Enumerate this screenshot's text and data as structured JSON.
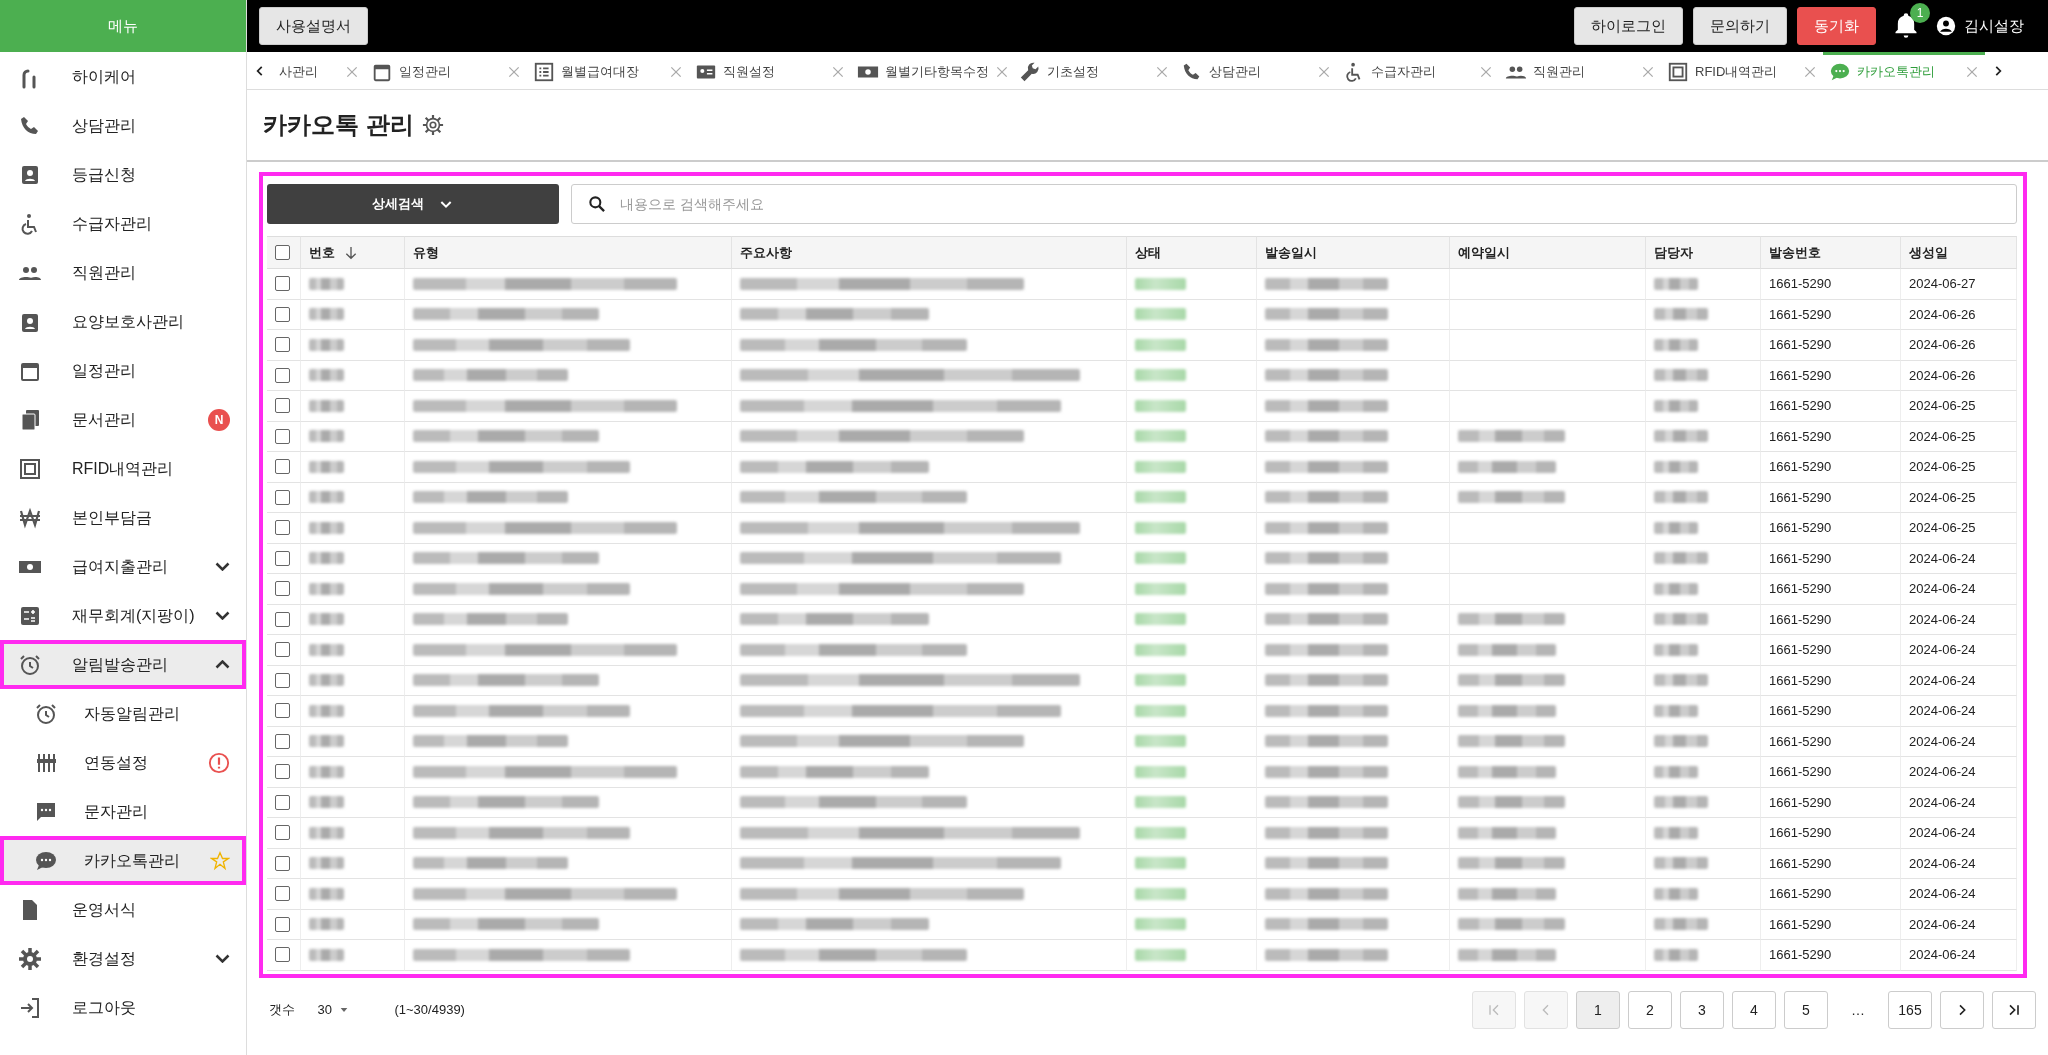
{
  "sidebar": {
    "title": "메뉴",
    "items": [
      {
        "label": "하이케어",
        "selected": false
      },
      {
        "label": "상담관리",
        "selected": false
      },
      {
        "label": "등급신청",
        "selected": false
      },
      {
        "label": "수급자관리",
        "selected": false
      },
      {
        "label": "직원관리",
        "selected": false
      },
      {
        "label": "요양보호사관리",
        "selected": false
      },
      {
        "label": "일정관리",
        "selected": false
      },
      {
        "label": "문서관리",
        "selected": false,
        "badge": "N"
      },
      {
        "label": "RFID내역관리",
        "selected": false
      },
      {
        "label": "본인부담금",
        "selected": false
      },
      {
        "label": "급여지출관리",
        "selected": false,
        "expanded": false
      },
      {
        "label": "재무회계(지팡이)",
        "selected": false,
        "expanded": false
      },
      {
        "label": "알림발송관리",
        "selected": true,
        "outlined": true,
        "expanded": true,
        "children": [
          {
            "label": "자동알림관리",
            "selected": false
          },
          {
            "label": "연동설정",
            "selected": false,
            "warning": true
          },
          {
            "label": "문자관리",
            "selected": false
          },
          {
            "label": "카카오톡관리",
            "selected": true,
            "outlined": true,
            "starred": false
          }
        ]
      },
      {
        "label": "운영서식",
        "selected": false
      },
      {
        "label": "환경설정",
        "selected": false,
        "expanded": false
      },
      {
        "label": "로그아웃",
        "selected": false
      }
    ]
  },
  "topbar": {
    "manual_button": "사용설명서",
    "buttons": [
      {
        "label": "하이로그인",
        "kind": "plain"
      },
      {
        "label": "문의하기",
        "kind": "plain"
      },
      {
        "label": "동기화",
        "kind": "danger"
      }
    ],
    "notification_count": "1",
    "user": "김시설장"
  },
  "tabs": [
    {
      "label": "사관리",
      "selected": false
    },
    {
      "label": "일정관리",
      "selected": false
    },
    {
      "label": "월별급여대장",
      "selected": false
    },
    {
      "label": "직원설정",
      "selected": false
    },
    {
      "label": "월별기타항목수정",
      "selected": false
    },
    {
      "label": "기초설정",
      "selected": false
    },
    {
      "label": "상담관리",
      "selected": false
    },
    {
      "label": "수급자관리",
      "selected": false
    },
    {
      "label": "직원관리",
      "selected": false
    },
    {
      "label": "RFID내역관리",
      "selected": false
    },
    {
      "label": "카카오톡관리",
      "selected": true
    }
  ],
  "page": {
    "title": "카카오톡 관리",
    "outlined": true
  },
  "search": {
    "filter_button": "상세검색",
    "placeholder": "내용으로 검색해주세요"
  },
  "table": {
    "all_checked": false,
    "columns": [
      "번호",
      "유형",
      "주요사항",
      "상태",
      "발송일시",
      "예약일시",
      "담당자",
      "발송번호",
      "생성일"
    ],
    "rows": [
      {
        "checked": false,
        "scheduled": false,
        "sender_number": "1661-5290",
        "created": "2024-06-27"
      },
      {
        "checked": false,
        "scheduled": false,
        "sender_number": "1661-5290",
        "created": "2024-06-26"
      },
      {
        "checked": false,
        "scheduled": false,
        "sender_number": "1661-5290",
        "created": "2024-06-26"
      },
      {
        "checked": false,
        "scheduled": false,
        "sender_number": "1661-5290",
        "created": "2024-06-26"
      },
      {
        "checked": false,
        "scheduled": false,
        "sender_number": "1661-5290",
        "created": "2024-06-25"
      },
      {
        "checked": false,
        "scheduled": true,
        "sender_number": "1661-5290",
        "created": "2024-06-25"
      },
      {
        "checked": false,
        "scheduled": true,
        "sender_number": "1661-5290",
        "created": "2024-06-25"
      },
      {
        "checked": false,
        "scheduled": true,
        "sender_number": "1661-5290",
        "created": "2024-06-25"
      },
      {
        "checked": false,
        "scheduled": false,
        "sender_number": "1661-5290",
        "created": "2024-06-25"
      },
      {
        "checked": false,
        "scheduled": false,
        "sender_number": "1661-5290",
        "created": "2024-06-24"
      },
      {
        "checked": false,
        "scheduled": false,
        "sender_number": "1661-5290",
        "created": "2024-06-24"
      },
      {
        "checked": false,
        "scheduled": true,
        "sender_number": "1661-5290",
        "created": "2024-06-24"
      },
      {
        "checked": false,
        "scheduled": true,
        "sender_number": "1661-5290",
        "created": "2024-06-24"
      },
      {
        "checked": false,
        "scheduled": true,
        "sender_number": "1661-5290",
        "created": "2024-06-24"
      },
      {
        "checked": false,
        "scheduled": true,
        "sender_number": "1661-5290",
        "created": "2024-06-24"
      },
      {
        "checked": false,
        "scheduled": true,
        "sender_number": "1661-5290",
        "created": "2024-06-24"
      },
      {
        "checked": false,
        "scheduled": true,
        "sender_number": "1661-5290",
        "created": "2024-06-24"
      },
      {
        "checked": false,
        "scheduled": true,
        "sender_number": "1661-5290",
        "created": "2024-06-24"
      },
      {
        "checked": false,
        "scheduled": true,
        "sender_number": "1661-5290",
        "created": "2024-06-24"
      },
      {
        "checked": false,
        "scheduled": true,
        "sender_number": "1661-5290",
        "created": "2024-06-24"
      },
      {
        "checked": false,
        "scheduled": true,
        "sender_number": "1661-5290",
        "created": "2024-06-24"
      },
      {
        "checked": false,
        "scheduled": true,
        "sender_number": "1661-5290",
        "created": "2024-06-24"
      },
      {
        "checked": false,
        "scheduled": true,
        "sender_number": "1661-5290",
        "created": "2024-06-24"
      }
    ]
  },
  "footer": {
    "count_label": "갯수",
    "page_size": "30",
    "range": "(1~30/4939)",
    "pages": [
      {
        "label": "1",
        "selected": true
      },
      {
        "label": "2",
        "selected": false
      },
      {
        "label": "3",
        "selected": false
      },
      {
        "label": "4",
        "selected": false
      },
      {
        "label": "5",
        "selected": false
      },
      {
        "label": "…",
        "selected": false
      },
      {
        "label": "165",
        "selected": false
      }
    ]
  }
}
